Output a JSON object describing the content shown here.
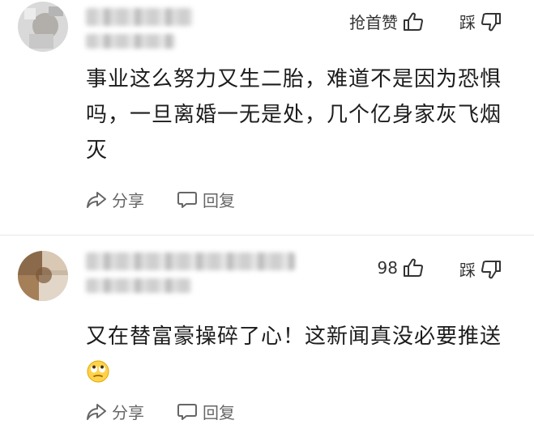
{
  "comments": [
    {
      "like_label": "抢首赞",
      "dislike_label": "踩",
      "text": "事业这么努力又生二胎，难道不是因为恐惧吗，一旦离婚一无是处，几个亿身家灰飞烟灭",
      "share_label": "分享",
      "reply_label": "回复"
    },
    {
      "like_label": "98",
      "dislike_label": "踩",
      "text": "又在替富豪操碎了心！这新闻真没必要推送",
      "emoji": "eye-roll-emoji",
      "share_label": "分享",
      "reply_label": "回复"
    }
  ]
}
